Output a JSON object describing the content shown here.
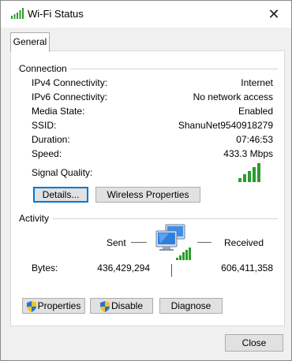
{
  "window": {
    "title": "Wi-Fi Status",
    "close_glyph": "✕"
  },
  "tabs": [
    {
      "label": "General"
    }
  ],
  "connection": {
    "heading": "Connection",
    "rows": [
      {
        "label": "IPv4 Connectivity:",
        "value": "Internet"
      },
      {
        "label": "IPv6 Connectivity:",
        "value": "No network access"
      },
      {
        "label": "Media State:",
        "value": "Enabled"
      },
      {
        "label": "SSID:",
        "value": "ShanuNet9540918279"
      },
      {
        "label": "Duration:",
        "value": "07:46:53"
      },
      {
        "label": "Speed:",
        "value": "433.3 Mbps"
      }
    ],
    "signal_label": "Signal Quality:",
    "signal_bars": 5,
    "details_button": "Details...",
    "wireless_button": "Wireless Properties"
  },
  "activity": {
    "heading": "Activity",
    "sent_label": "Sent",
    "received_label": "Received",
    "bytes_label": "Bytes:",
    "bytes_sent": "436,429,294",
    "bytes_received": "606,411,358",
    "icon": "network-computers-icon"
  },
  "buttons": {
    "properties": "Properties",
    "disable": "Disable",
    "diagnose": "Diagnose",
    "close": "Close"
  },
  "colors": {
    "signal": "#2a9d2a",
    "focus": "#0078d7",
    "shield_blue": "#2b6fd6",
    "shield_yellow": "#f2c618"
  }
}
